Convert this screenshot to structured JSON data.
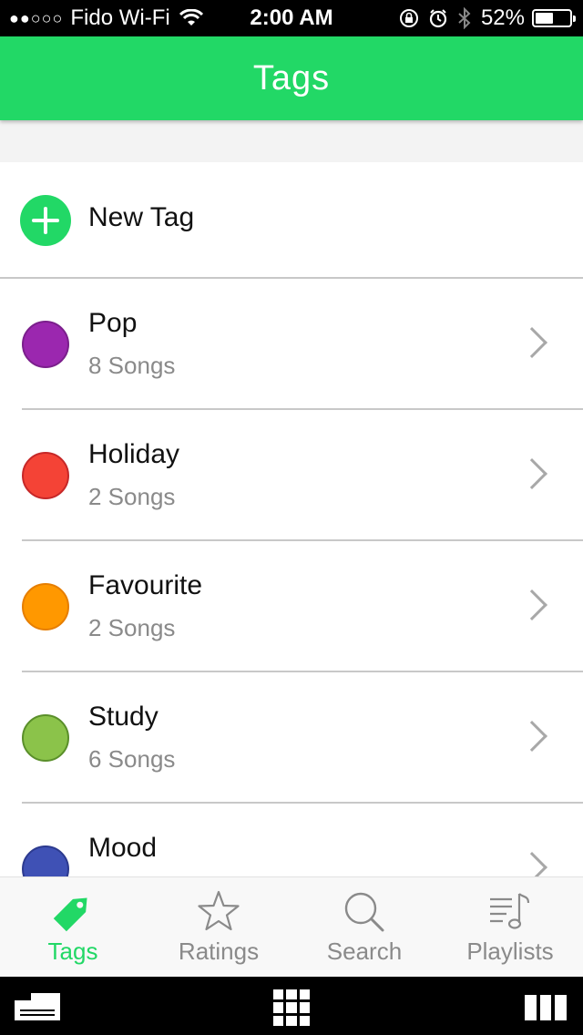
{
  "status_bar": {
    "signal": "●●○○○",
    "carrier": "Fido Wi-Fi",
    "time": "2:00 AM",
    "battery_percent": "52%",
    "battery_level": 0.52,
    "icons": [
      "wifi-icon",
      "rotation-lock-icon",
      "alarm-icon",
      "bluetooth-icon",
      "battery-icon"
    ]
  },
  "nav": {
    "title": "Tags"
  },
  "new_tag": {
    "label": "New Tag",
    "icon": "plus-circle-icon",
    "color": "#22d866"
  },
  "tags": [
    {
      "name": "Pop",
      "count": "8 Songs",
      "color": "#9b27af",
      "border": "#7b1f8c"
    },
    {
      "name": "Holiday",
      "count": "2 Songs",
      "color": "#f44336",
      "border": "#c62828"
    },
    {
      "name": "Favourite",
      "count": "2 Songs",
      "color": "#ff9800",
      "border": "#e67e00"
    },
    {
      "name": "Study",
      "count": "6 Songs",
      "color": "#8bc34a",
      "border": "#5a8f2a"
    },
    {
      "name": "Mood",
      "count": "",
      "color": "#3f51b5",
      "border": "#2c3a8f"
    }
  ],
  "tab_bar": {
    "tabs": [
      {
        "label": "Tags",
        "icon": "tag-icon",
        "active": true
      },
      {
        "label": "Ratings",
        "icon": "star-icon",
        "active": false
      },
      {
        "label": "Search",
        "icon": "search-icon",
        "active": false
      },
      {
        "label": "Playlists",
        "icon": "playlist-icon",
        "active": false
      }
    ]
  },
  "colors": {
    "accent": "#22d866",
    "inactive": "#8a8a8a"
  }
}
